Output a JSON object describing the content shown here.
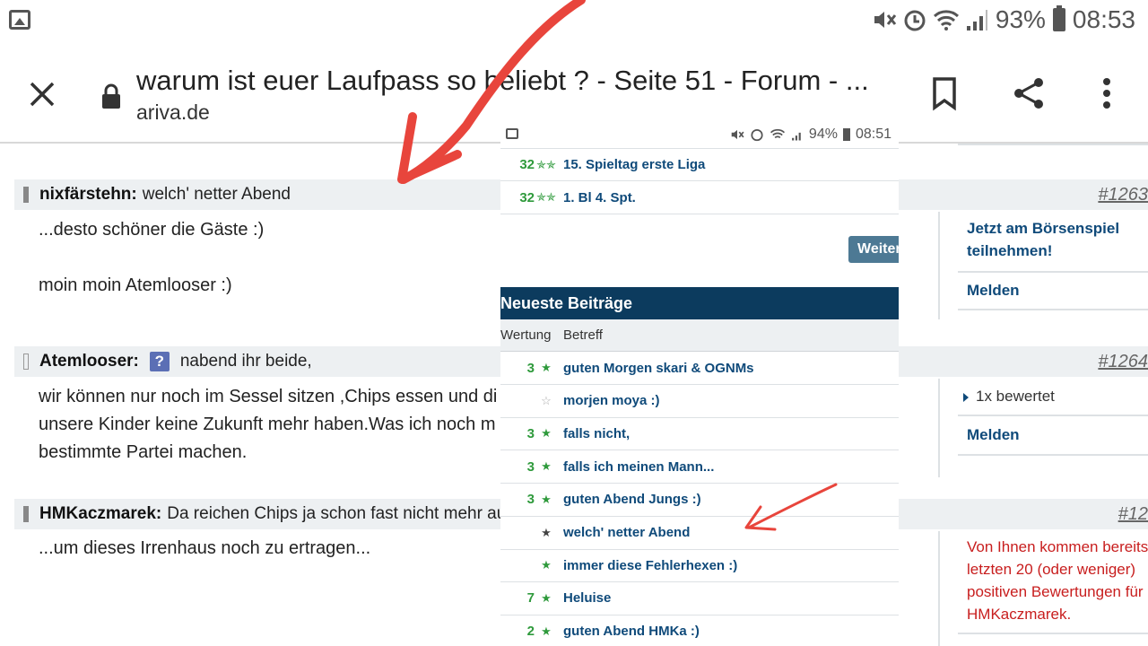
{
  "status_bar": {
    "battery": "93%",
    "time": "08:53"
  },
  "browser": {
    "title": "warum ist euer Laufpass so beliebt ? - Seite 51 - Forum - ...",
    "domain": "ariva.de"
  },
  "posts": [
    {
      "author": "nixfärstehn:",
      "subject": "welch' netter Abend",
      "number": "#1263",
      "body": [
        "...desto  schöner die Gäste   :)",
        "",
        "moin moin Atemlooser   :)"
      ]
    },
    {
      "author": "Atemlooser:",
      "subject": "nabend ihr beide,",
      "number": "#1264",
      "badge": "?",
      "body": [
        "wir können nur noch im Sessel sitzen ,Chips essen und di",
        "unsere Kinder keine Zukunft mehr haben.Was ich noch m",
        "bestimmte Partei machen."
      ]
    },
    {
      "author": "HMKaczmarek:",
      "subject": "Da reichen Chips ja schon fast nicht mehr au",
      "number": "#12",
      "body": [
        "...um dieses Irrenhaus noch zu ertragen..."
      ]
    }
  ],
  "sidebar": {
    "boersenspiel": [
      "Jetzt am Börsenspiel",
      "teilnehmen!"
    ],
    "melden_1": "Melden",
    "rated": "1x bewertet",
    "melden_2": "Melden",
    "notice": [
      "Von Ihnen kommen bereits",
      "letzten 20 (oder weniger)",
      "positiven Bewertungen für",
      "HMKaczmarek."
    ]
  },
  "overlay": {
    "status": {
      "battery": "94%",
      "time": "08:51"
    },
    "top_rows": [
      {
        "score": "32",
        "subject": "15. Spieltag erste Liga"
      },
      {
        "score": "32",
        "subject": "1. Bl 4. Spt."
      }
    ],
    "more_button": "Weiter",
    "section_title": "Neueste Beiträge",
    "columns": {
      "rating": "Wertung",
      "subject": "Betreff"
    },
    "rows": [
      {
        "score": "3",
        "star": "filled",
        "subject": "guten Morgen skari & OGNMs"
      },
      {
        "score": "",
        "star": "empty",
        "subject": "morjen moya :)"
      },
      {
        "score": "3",
        "star": "filled",
        "subject": "falls nicht,"
      },
      {
        "score": "3",
        "star": "filled",
        "subject": "falls ich meinen Mann..."
      },
      {
        "score": "3",
        "star": "filled",
        "subject": "guten Abend Jungs :)"
      },
      {
        "score": "",
        "star": "dark",
        "subject": "welch' netter Abend"
      },
      {
        "score": "",
        "star": "filled",
        "subject": "immer diese Fehlerhexen :)"
      },
      {
        "score": "7",
        "star": "filled",
        "subject": "Heluise"
      },
      {
        "score": "2",
        "star": "filled",
        "subject": "guten Abend HMKa :)"
      }
    ]
  },
  "colors": {
    "accent_red": "#e8453c",
    "section_blue": "#0c3b5e",
    "link_blue": "#0f4a7a",
    "score_green": "#2f9a3c",
    "notice_red": "#c81e1e"
  },
  "icons": [
    "close-icon",
    "lock-icon",
    "bookmark-icon",
    "share-icon",
    "more-vert-icon",
    "gallery-icon",
    "mute-icon",
    "alarm-icon",
    "wifi-icon",
    "signal-icon",
    "battery-icon",
    "star-icon",
    "question-icon"
  ]
}
